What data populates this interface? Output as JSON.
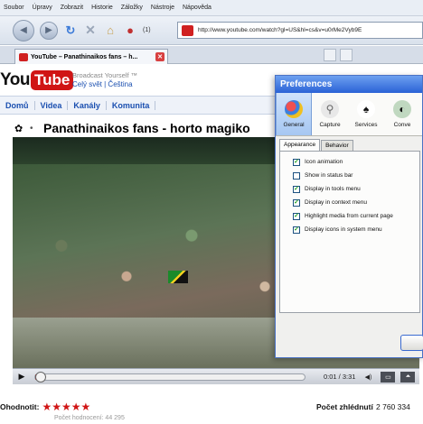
{
  "menu": [
    "Soubor",
    "Úpravy",
    "Zobrazit",
    "Historie",
    "Záložky",
    "Nástroje",
    "Nápověda"
  ],
  "toolbar": {
    "download_count": "(1)",
    "url": "http://www.youtube.com/watch?gl=US&hl=cs&v=u0rMe2Vyb9E"
  },
  "tab": {
    "title": "YouTube – Panathinaikos fans – h..."
  },
  "youtube": {
    "logo_you": "You",
    "logo_tube": "Tube",
    "tagline": "Broadcast Yourself ™",
    "country": "Celý svět | Čeština",
    "nav": [
      "Domů",
      "Videa",
      "Kanály",
      "Komunita"
    ],
    "video_title": "Panathinaikos fans - horto magiko",
    "player": {
      "time": "0:01 / 3:31",
      "progress": 0.008
    },
    "rating_label": "Ohodnotit:",
    "stars": 5,
    "rating_count": "Počet hodnocení: 44 295",
    "views_label": "Počet zhlédnutí",
    "views_value": "2 760 334"
  },
  "prefs": {
    "title": "Preferences",
    "tools": [
      {
        "label": "General",
        "icon": "general-icon",
        "active": true
      },
      {
        "label": "Capture",
        "icon": "capture-icon",
        "active": false
      },
      {
        "label": "Services",
        "icon": "services-icon",
        "active": false
      },
      {
        "label": "Conve",
        "icon": "convert-icon",
        "active": false
      }
    ],
    "subtabs": [
      "Appearance",
      "Behavior"
    ],
    "options": [
      {
        "label": "Icon animation",
        "checked": true
      },
      {
        "label": "Show in status bar",
        "checked": false
      },
      {
        "label": "Display in tools menu",
        "checked": true
      },
      {
        "label": "Display in context menu",
        "checked": true
      },
      {
        "label": "Highlight media from current page",
        "checked": true
      },
      {
        "label": "Display icons in system menu",
        "checked": true
      }
    ]
  }
}
